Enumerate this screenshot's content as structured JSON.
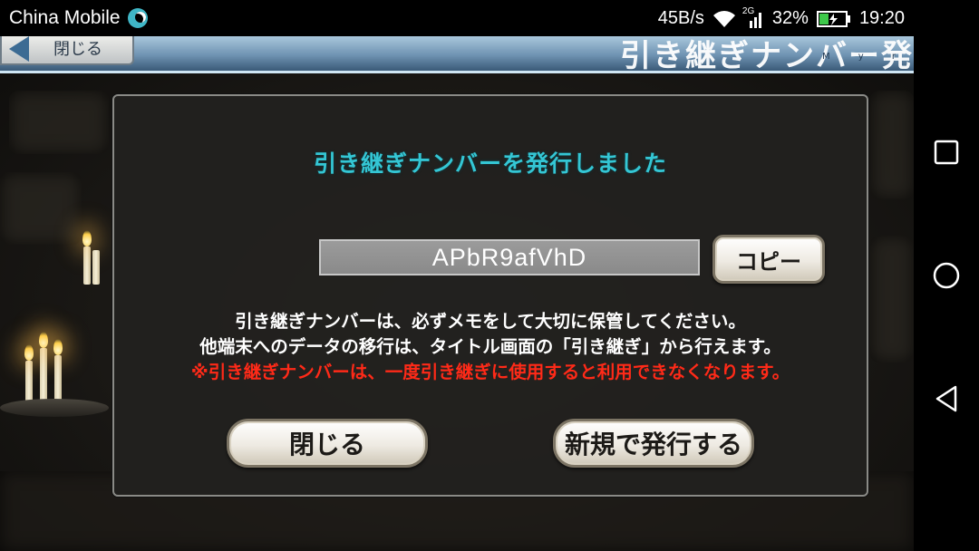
{
  "status_bar": {
    "carrier": "China Mobile",
    "net_speed": "45B/s",
    "network_type": "2G",
    "battery": "32%",
    "time": "19:20",
    "icons": [
      "moon-icon",
      "wifi-icon",
      "signal-icon",
      "battery-charging-icon"
    ]
  },
  "header": {
    "back_label": "閉じる",
    "title_fragment": "引き継ぎナンバー発",
    "subtitle_fragment": "M y r"
  },
  "dialog": {
    "title": "引き継ぎナンバーを発行しました",
    "transfer_code": "APbR9afVhD",
    "copy_label": "コピー",
    "notice_line1": "引き継ぎナンバーは、必ずメモをして大切に保管してください。",
    "notice_line2": "他端末へのデータの移行は、タイトル画面の「引き継ぎ」から行えます。",
    "warning_line": "※引き継ぎナンバーは、一度引き継ぎに使用すると利用できなくなります。",
    "close_label": "閉じる",
    "reissue_label": "新規で発行する"
  },
  "colors": {
    "title_cyan": "#34c6d4",
    "warning_red": "#ff2a18",
    "dialog_bg": "#22211f"
  },
  "nav_bar": {
    "icons": [
      "recent-apps-icon",
      "home-icon",
      "back-icon"
    ]
  }
}
